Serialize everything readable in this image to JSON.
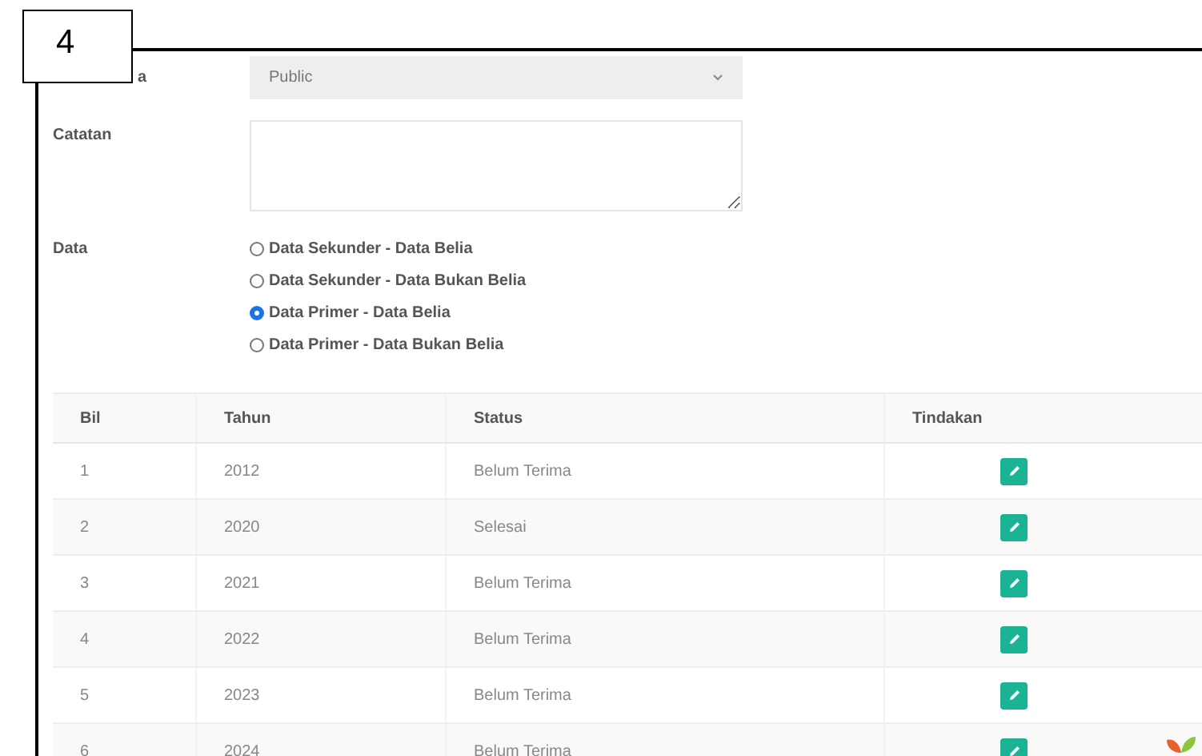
{
  "annotation": {
    "label": "4"
  },
  "form": {
    "access": {
      "label": "a",
      "value": "Public"
    },
    "notes": {
      "label": "Catatan"
    },
    "data": {
      "label": "Data",
      "options": [
        {
          "label": "Data Sekunder - Data Belia",
          "selected": false
        },
        {
          "label": "Data Sekunder - Data Bukan Belia",
          "selected": false
        },
        {
          "label": "Data Primer - Data Belia",
          "selected": true
        },
        {
          "label": "Data Primer - Data Bukan Belia",
          "selected": false
        }
      ]
    }
  },
  "table": {
    "columns": [
      "Bil",
      "Tahun",
      "Status",
      "Tindakan"
    ],
    "rows": [
      {
        "bil": "1",
        "tahun": "2012",
        "status": "Belum Terima"
      },
      {
        "bil": "2",
        "tahun": "2020",
        "status": "Selesai"
      },
      {
        "bil": "3",
        "tahun": "2021",
        "status": "Belum Terima"
      },
      {
        "bil": "4",
        "tahun": "2022",
        "status": "Belum Terima"
      },
      {
        "bil": "5",
        "tahun": "2023",
        "status": "Belum Terima"
      },
      {
        "bil": "6",
        "tahun": "2024",
        "status": "Belum Terima"
      }
    ]
  }
}
